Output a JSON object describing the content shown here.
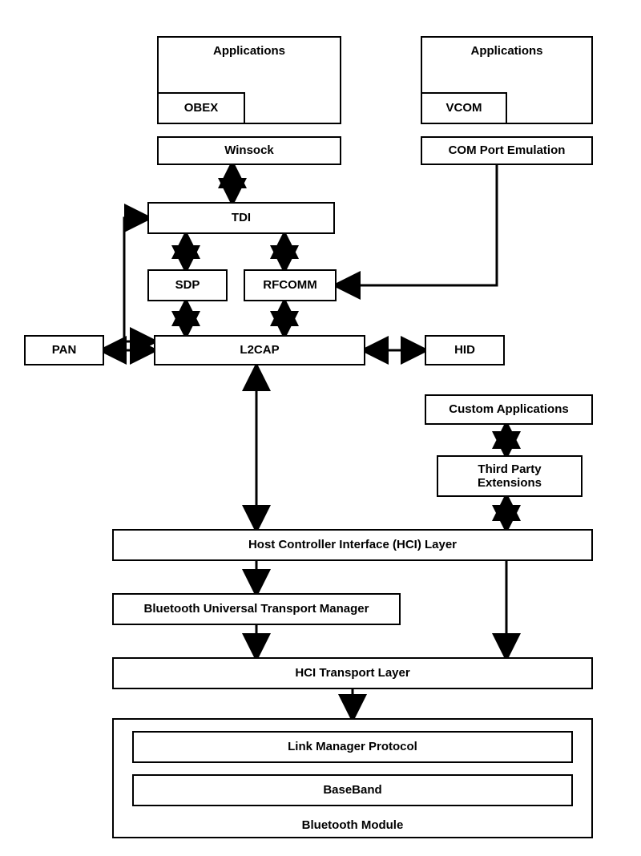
{
  "labels": {
    "applications_left": "Applications",
    "applications_right": "Applications",
    "obex": "OBEX",
    "vcom": "VCOM",
    "winsock": "Winsock",
    "com_port_emulation": "COM Port Emulation",
    "tdi": "TDI",
    "sdp": "SDP",
    "rfcomm": "RFCOMM",
    "pan": "PAN",
    "l2cap": "L2CAP",
    "hid": "HID",
    "custom_apps": "Custom Applications",
    "third_party_ext": "Third Party\nExtensions",
    "hci_layer": "Host Controller Interface (HCI) Layer",
    "butm": "Bluetooth Universal Transport Manager",
    "hci_transport": "HCI Transport Layer",
    "link_manager": "Link Manager Protocol",
    "baseband": "BaseBand",
    "bluetooth_module": "Bluetooth Module"
  }
}
